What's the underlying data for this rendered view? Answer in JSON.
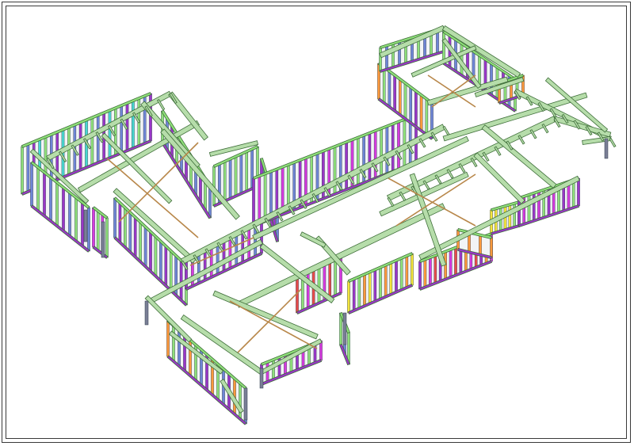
{
  "drawing": {
    "kind": "3d-isometric-building-frame",
    "colors": {
      "truss_fill": "#b6ddaa",
      "truss_stroke": "#3f6f3a",
      "wall_green": "#8fe07a",
      "wall_purple": "#9a36c8",
      "wall_magenta": "#d63adf",
      "wall_blue": "#6f86d6",
      "wall_cyan": "#48d8d0",
      "wall_yellow": "#f4e63c",
      "wall_orange": "#ff9a3c",
      "wall_red": "#e84b4b",
      "brace": "#b8874a",
      "post": "#7a7f96",
      "frame_border": "#3a3a3a"
    }
  }
}
